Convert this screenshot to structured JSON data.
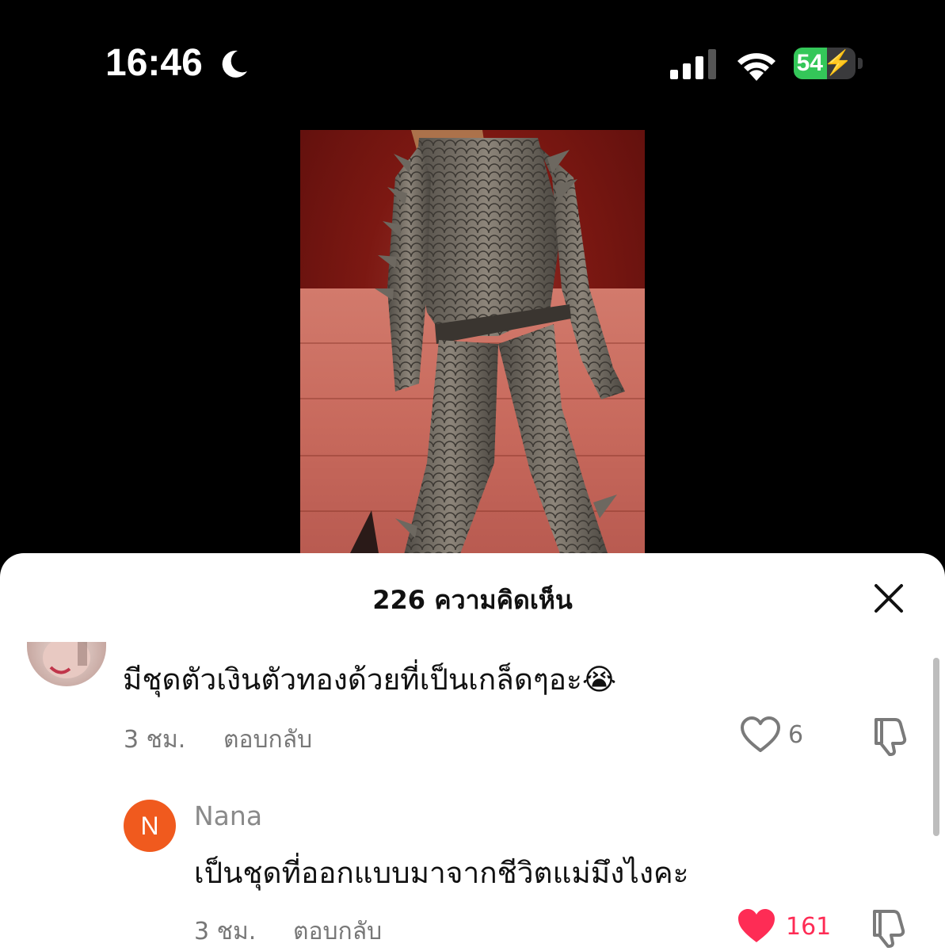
{
  "status_bar": {
    "time": "16:46",
    "battery": "54",
    "battery_level_percent": 54,
    "icons": [
      "moon-icon",
      "cellular-signal-icon",
      "wifi-icon",
      "battery-charging-icon"
    ]
  },
  "sheet": {
    "title": "226 ความคิดเห็น",
    "close_icon": "close-icon"
  },
  "comments": [
    {
      "text": "มีชุดตัวเงินตัวทองด้วยที่เป็นเกล็ดๆอะ😭",
      "time": "3 ชม.",
      "reply_label": "ตอบกลับ",
      "likes": "6",
      "liked": false
    },
    {
      "avatar_initial": "N",
      "username": "Nana",
      "text": "เป็นชุดที่ออกแบบมาจากชีวิตแม่มึงไงคะ",
      "time": "3 ชม.",
      "reply_label": "ตอบกลับ",
      "likes": "161",
      "liked": true
    }
  ],
  "colors": {
    "liked_heart": "#fe2c55",
    "avatar_nana": "#f05a1e",
    "battery_fill": "#34c759"
  }
}
